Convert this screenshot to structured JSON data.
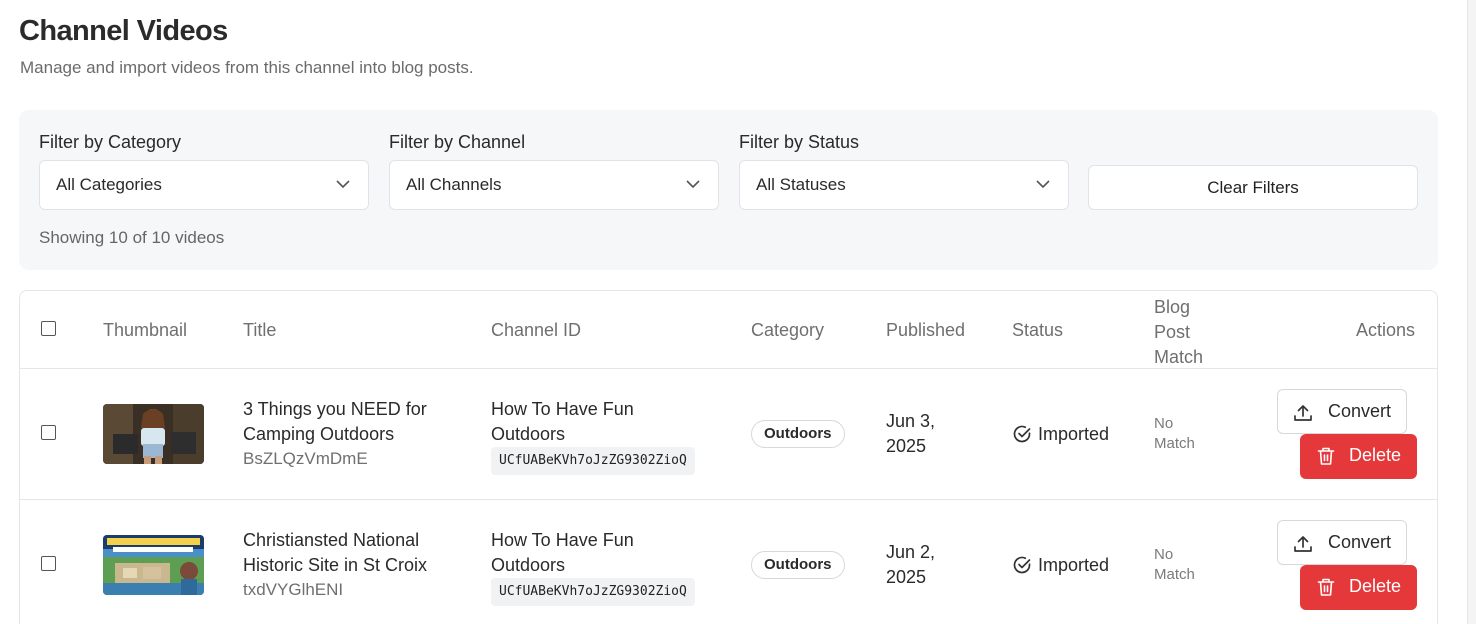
{
  "page": {
    "title": "Channel Videos",
    "subtitle": "Manage and import videos from this channel into blog posts."
  },
  "filters": {
    "category": {
      "label": "Filter by Category",
      "value": "All Categories"
    },
    "channel": {
      "label": "Filter by Channel",
      "value": "All Channels"
    },
    "status": {
      "label": "Filter by Status",
      "value": "All Statuses"
    },
    "clear_label": "Clear Filters",
    "showing_text": "Showing 10 of 10 videos"
  },
  "table": {
    "headers": {
      "thumbnail": "Thumbnail",
      "title": "Title",
      "channel_id": "Channel ID",
      "category": "Category",
      "published": "Published",
      "status": "Status",
      "blog_post_match_1": "Blog",
      "blog_post_match_2": "Post",
      "blog_post_match_3": "Match",
      "actions": "Actions"
    },
    "rows": [
      {
        "title": "3 Things you NEED for Camping Outdoors",
        "video_id": "BsZLQzVmDmE",
        "channel_name": "How To Have Fun Outdoors",
        "channel_code": "UCfUABeKVh7oJzZG9302ZioQ",
        "category": "Outdoors",
        "published_1": "Jun 3,",
        "published_2": "2025",
        "status": "Imported",
        "match_1": "No",
        "match_2": "Match",
        "convert_label": "Convert",
        "delete_label": "Delete"
      },
      {
        "title": "Christiansted National Historic Site in St Croix",
        "video_id": "txdVYGlhENI",
        "channel_name": "How To Have Fun Outdoors",
        "channel_code": "UCfUABeKVh7oJzZG9302ZioQ",
        "category": "Outdoors",
        "published_1": "Jun 2,",
        "published_2": "2025",
        "status": "Imported",
        "match_1": "No",
        "match_2": "Match",
        "convert_label": "Convert",
        "delete_label": "Delete"
      }
    ]
  },
  "colors": {
    "delete": "#e5383b",
    "panel": "#f6f7f9",
    "border": "#e4e6ea"
  }
}
